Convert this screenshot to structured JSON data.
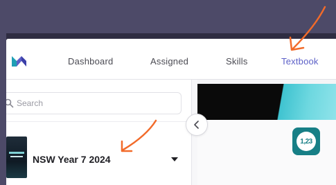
{
  "header": {
    "logo": "m-logo-icon",
    "tabs": [
      {
        "label": "Dashboard",
        "active": false
      },
      {
        "label": "Assigned",
        "active": false
      },
      {
        "label": "Skills",
        "active": false
      },
      {
        "label": "Textbook",
        "active": true
      }
    ]
  },
  "sidebar": {
    "search": {
      "placeholder": "Search",
      "value": ""
    },
    "course": {
      "title": "NSW Year 7 2024"
    },
    "collapse_icon": "chevron-left-icon"
  },
  "main": {
    "resource_icon_text": "1,23"
  },
  "colors": {
    "active_tab": "#5b5fc7",
    "annotation_arrow": "#f26b2a",
    "teal": "#177f86",
    "banner_cyan": "#3fc3d0"
  }
}
